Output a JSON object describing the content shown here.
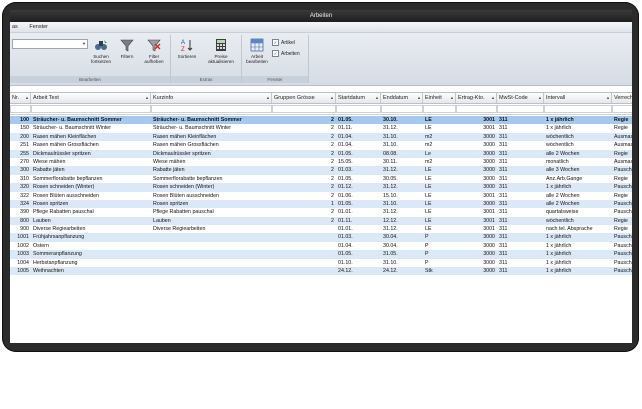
{
  "window": {
    "title": "Arbeiten"
  },
  "menu": [
    "as",
    "Fenster"
  ],
  "ribbon": {
    "groups": [
      {
        "label": "Bearbeiten"
      },
      {
        "label": "Extras"
      },
      {
        "label": "Fenster"
      }
    ],
    "buttons": {
      "suchen": "Suchen fortsetzen",
      "filtern": "Filtern",
      "filter_aufheben": "Filter aufheben",
      "sortieren": "Sortieren",
      "preise": "Preise aktualisieren",
      "arbeit_bearbeiten": "Arbeit bearbeiten"
    },
    "checkboxes": [
      {
        "label": "Artikel",
        "checked": true
      },
      {
        "label": "Arbeiten",
        "checked": true
      }
    ]
  },
  "columns": [
    "Nr.",
    "Arbeit Text",
    "Kurzinfo",
    "Gruppen Grösse",
    "Startdatum",
    "Enddatum",
    "Einheit",
    "Ertrag-Kto.",
    "MwSt-Code",
    "Intervall",
    "Verrechnung"
  ],
  "rows": [
    {
      "nr": "100",
      "text": "Sträucher- u. Baumschnitt Sommer",
      "kurz": "Sträucher- u. Baumschnitt Sommer",
      "gr": "2",
      "start": "01.05.",
      "end": "30.10.",
      "einheit": "LE",
      "kto": "3001",
      "mwst": "311",
      "intervall": "1 x jährlich",
      "verr": "Regie",
      "style": "sel"
    },
    {
      "nr": "150",
      "text": "Sträucher- u. Baumschnitt Winter",
      "kurz": "Sträucher- u. Baumschnitt Winter",
      "gr": "2",
      "start": "01.11.",
      "end": "31.12.",
      "einheit": "LE",
      "kto": "3001",
      "mwst": "311",
      "intervall": "1 x jährlich",
      "verr": "Regie",
      "style": ""
    },
    {
      "nr": "200",
      "text": "Rasen mähen Kleinflächen",
      "kurz": "Rasen mähen Kleinflächen",
      "gr": "2",
      "start": "01.04.",
      "end": "31.10.",
      "einheit": "m2",
      "kto": "3000",
      "mwst": "311",
      "intervall": "wöchentlich",
      "verr": "Ausmass",
      "style": "alt"
    },
    {
      "nr": "251",
      "text": "Rasen mähen Grossflächen",
      "kurz": "Rasen mähen Grossflächen",
      "gr": "2",
      "start": "01.04.",
      "end": "31.10.",
      "einheit": "m2",
      "kto": "3000",
      "mwst": "311",
      "intervall": "wöchentlich",
      "verr": "Ausmass",
      "style": ""
    },
    {
      "nr": "255",
      "text": "Dickmaulrüssler spritzen",
      "kurz": "Dickmaulrüssler spritzen",
      "gr": "2",
      "start": "01.05.",
      "end": "08.08.",
      "einheit": "Le",
      "kto": "3000",
      "mwst": "311",
      "intervall": "alle 2 Wochen",
      "verr": "Regie",
      "style": "alt"
    },
    {
      "nr": "270",
      "text": "Wiese mähen",
      "kurz": "Wiese mähen",
      "gr": "2",
      "start": "15.05.",
      "end": "30.11.",
      "einheit": "m2",
      "kto": "3000",
      "mwst": "311",
      "intervall": "monatlich",
      "verr": "Ausmass",
      "style": ""
    },
    {
      "nr": "300",
      "text": "Rabatte jäten",
      "kurz": "Rabatte jäten",
      "gr": "2",
      "start": "01.03.",
      "end": "31.12.",
      "einheit": "LE",
      "kto": "3000",
      "mwst": "311",
      "intervall": "alle 3 Wochen",
      "verr": "Pauschal",
      "style": "alt"
    },
    {
      "nr": "310",
      "text": "Sommerflorabatte bepflanzen",
      "kurz": "Sommerflorabatte bepflanzen",
      "gr": "2",
      "start": "01.05.",
      "end": "30.05.",
      "einheit": "LE",
      "kto": "3000",
      "mwst": "311",
      "intervall": "Anz.Arb.Gange",
      "verr": "Regie",
      "style": ""
    },
    {
      "nr": "320",
      "text": "Rosen schneiden (Winter)",
      "kurz": "Rosen schneiden (Winter)",
      "gr": "2",
      "start": "01.12.",
      "end": "31.12.",
      "einheit": "LE",
      "kto": "3000",
      "mwst": "311",
      "intervall": "1 x jährlich",
      "verr": "Pauschal",
      "style": "alt"
    },
    {
      "nr": "322",
      "text": "Rosen Blüten ausschneiden",
      "kurz": "Rosen Blüten ausschneiden",
      "gr": "2",
      "start": "01.06.",
      "end": "15.10.",
      "einheit": "LE",
      "kto": "3001",
      "mwst": "311",
      "intervall": "alle 2 Wochen",
      "verr": "Regie",
      "style": ""
    },
    {
      "nr": "324",
      "text": "Rosen spritzen",
      "kurz": "Rosen spritzen",
      "gr": "1",
      "start": "01.05.",
      "end": "31.10.",
      "einheit": "LE",
      "kto": "3000",
      "mwst": "311",
      "intervall": "alle 2 Wochen",
      "verr": "Pauschal",
      "style": "alt"
    },
    {
      "nr": "390",
      "text": "Pflege Rabatten pauschal",
      "kurz": "Pflege Rabatten pauschal",
      "gr": "2",
      "start": "01.01.",
      "end": "31.12.",
      "einheit": "LE",
      "kto": "3001",
      "mwst": "311",
      "intervall": "quartalsweise",
      "verr": "Pauschal",
      "style": ""
    },
    {
      "nr": "800",
      "text": "Lauben",
      "kurz": "Lauben",
      "gr": "2",
      "start": "01.11.",
      "end": "12.12.",
      "einheit": "LE",
      "kto": "3001",
      "mwst": "311",
      "intervall": "wöchentlich",
      "verr": "Regie",
      "style": "alt"
    },
    {
      "nr": "900",
      "text": "Diverse Regiearbeiten",
      "kurz": "Diverse Regiearbeiten",
      "gr": "",
      "start": "01.01.",
      "end": "31.12.",
      "einheit": "LE",
      "kto": "3001",
      "mwst": "311",
      "intervall": "nach tel. Absprache",
      "verr": "Regie",
      "style": ""
    },
    {
      "nr": "1001",
      "text": "Frühjahrsanpflanzung",
      "kurz": "",
      "gr": "",
      "start": "01.03.",
      "end": "30.04.",
      "einheit": "P",
      "kto": "3000",
      "mwst": "311",
      "intervall": "1 x jährlich",
      "verr": "Pauschal",
      "style": "alt"
    },
    {
      "nr": "1002",
      "text": "Ostern",
      "kurz": "",
      "gr": "",
      "start": "01.04.",
      "end": "30.04.",
      "einheit": "P",
      "kto": "3000",
      "mwst": "311",
      "intervall": "1 x jährlich",
      "verr": "Pauschal",
      "style": ""
    },
    {
      "nr": "1003",
      "text": "Sommeranpflanzung",
      "kurz": "",
      "gr": "",
      "start": "01.05.",
      "end": "31.05.",
      "einheit": "P",
      "kto": "3000",
      "mwst": "311",
      "intervall": "1 x jährlich",
      "verr": "Pauschal",
      "style": "alt"
    },
    {
      "nr": "1004",
      "text": "Herbstanpflanzung",
      "kurz": "",
      "gr": "",
      "start": "01.10.",
      "end": "31.10.",
      "einheit": "P",
      "kto": "3000",
      "mwst": "311",
      "intervall": "1 x jährlich",
      "verr": "Pauschal",
      "style": ""
    },
    {
      "nr": "1005",
      "text": "Weihnachten",
      "kurz": "",
      "gr": "",
      "start": "24.12.",
      "end": "24.12.",
      "einheit": "Stk",
      "kto": "3000",
      "mwst": "311",
      "intervall": "1 x jährlich",
      "verr": "Pauschal",
      "style": "alt"
    }
  ]
}
